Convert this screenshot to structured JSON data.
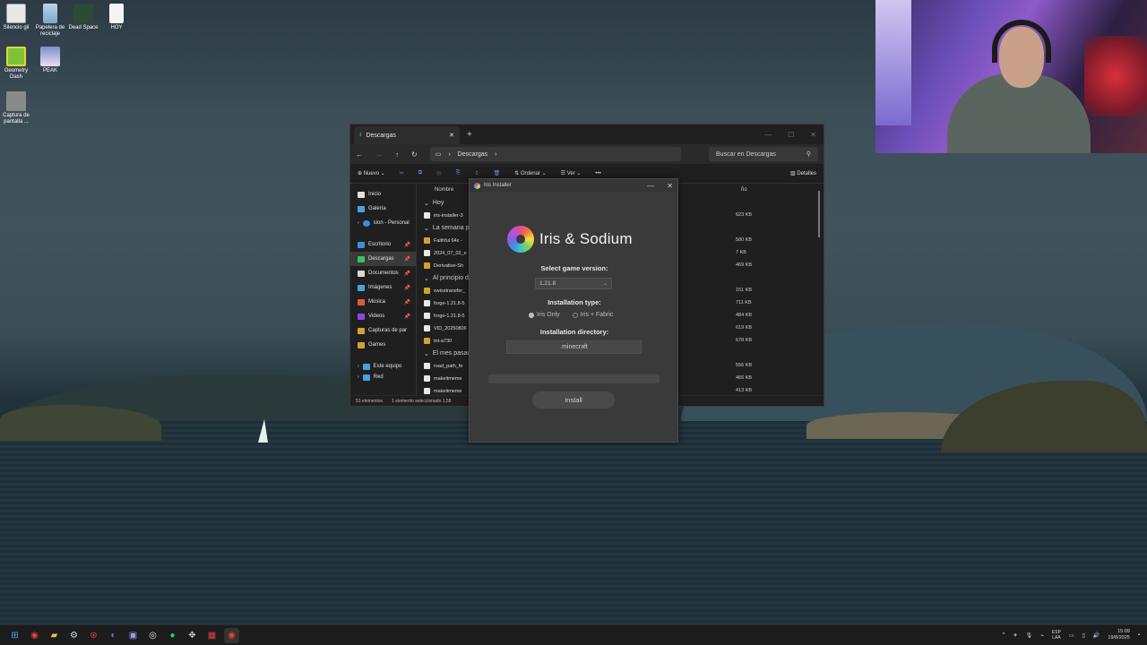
{
  "desktop": {
    "icons": [
      {
        "label": "Silencio gil"
      },
      {
        "label": "Papelera de reciclaje"
      },
      {
        "label": "Dead Space"
      },
      {
        "label": "HOY"
      },
      {
        "label": "Geometry Dash"
      },
      {
        "label": "PEAK"
      },
      {
        "label": "Captura de pantalla ..."
      }
    ]
  },
  "explorer": {
    "tab_title": "Descargas",
    "breadcrumb": "Descargas",
    "search_placeholder": "Buscar en Descargas",
    "commands": {
      "new": "Nuevo",
      "sort": "Ordenar",
      "view": "Ver",
      "details": "Detalles"
    },
    "nav": [
      {
        "label": "Inicio"
      },
      {
        "label": "Galería"
      },
      {
        "label": "sion - Personal"
      },
      {
        "label": "Escritorio"
      },
      {
        "label": "Descargas"
      },
      {
        "label": "Documentos"
      },
      {
        "label": "Imágenes"
      },
      {
        "label": "Música"
      },
      {
        "label": "Videos"
      },
      {
        "label": "Capturas de par"
      },
      {
        "label": "Games"
      },
      {
        "label": "Este equipo"
      },
      {
        "label": "Red"
      }
    ],
    "column_name": "Nombre",
    "column_size": "ño",
    "groups": {
      "today": "Hoy",
      "last_week": "La semana pa",
      "month_start": "Al principio d",
      "last_month": "El mes pasad"
    },
    "files": [
      {
        "name": "iris-installer-3",
        "size": "623 KB"
      },
      {
        "name": "Faithful 64x -",
        "size": "580 KB"
      },
      {
        "name": "2024_07_02_e",
        "size": "7 KB"
      },
      {
        "name": "Derivative-Sh",
        "size": "469 KB"
      },
      {
        "name": "swisstransfer_",
        "size": "151 KB"
      },
      {
        "name": "forge-1.21.8-5",
        "size": "711 KB"
      },
      {
        "name": "forge-1.21.8-5",
        "size": "484 KB"
      },
      {
        "name": "VID_20250806",
        "size": "619 KB"
      },
      {
        "name": "tnt-a730",
        "size": "678 KB"
      },
      {
        "name": "road_path_fe",
        "size": "556 KB"
      },
      {
        "name": "makeitmeme",
        "size": "466 KB"
      },
      {
        "name": "makeitmeme",
        "size": "413 KB"
      }
    ],
    "status": {
      "count": "53 elementos",
      "selected": "1 elemento seleccionado  1,58"
    }
  },
  "installer": {
    "window_title": "Iris Installer",
    "brand": "Iris & Sodium",
    "version_label": "Select game version:",
    "version_value": "1.21.8",
    "type_label": "Installation type:",
    "option_iris": "Iris Only",
    "option_fabric": "Iris + Fabric",
    "selected_option": "Iris Only",
    "dir_label": "Installation directory:",
    "dir_value": ".minecraft",
    "install_button": "Install"
  },
  "taskbar": {
    "lang_top": "ESP",
    "lang_bottom": "LAA",
    "time": "15:09",
    "date": "19/8/2025"
  }
}
